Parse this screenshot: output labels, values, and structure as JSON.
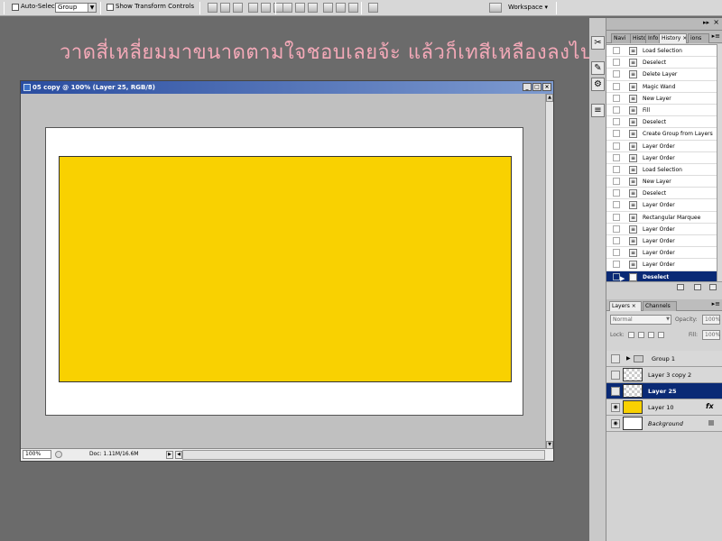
{
  "options_bar": {
    "auto_select_label": "Auto-Select:",
    "auto_select_value": "Group",
    "show_transform_label": "Show Transform Controls",
    "workspace_label": "Workspace"
  },
  "overlay_text": "วาดสี่เหลี่ยมมาขนาดตามใจชอบเลยจ้ะ แล้วก็เทสีเหลืองลงไป",
  "document": {
    "title": "05 copy @ 100% (Layer 25, RGB/8)",
    "zoom": "100%",
    "doc_info": "Doc: 1.11M/16.6M",
    "window_buttons": [
      "_",
      "□",
      "×"
    ],
    "rectangle_color": "#f9d101"
  },
  "history_panel": {
    "tabs": [
      "Navi",
      "Histo",
      "Info",
      "History",
      "ions"
    ],
    "items": [
      "Load Selection",
      "Deselect",
      "Delete Layer",
      "Magic Wand",
      "New Layer",
      "Fill",
      "Deselect",
      "Create Group from Layers",
      "Layer Order",
      "Layer Order",
      "Load Selection",
      "New Layer",
      "Deselect",
      "Layer Order",
      "Rectangular Marquee",
      "Layer Order",
      "Layer Order",
      "Layer Order",
      "Layer Order",
      "Deselect"
    ],
    "selected_item": "Deselect"
  },
  "layers_panel": {
    "tabs": [
      "Layers",
      "Channels"
    ],
    "blend_mode": "Normal",
    "opacity_label": "Opacity:",
    "opacity_value": "100%",
    "lock_label": "Lock:",
    "fill_label": "Fill:",
    "fill_value": "100%",
    "layers": [
      {
        "name": "Group 1",
        "kind": "group",
        "visible": false,
        "selected": false
      },
      {
        "name": "Layer 3 copy 2",
        "kind": "layer",
        "visible": false,
        "selected": false
      },
      {
        "name": "Layer 25",
        "kind": "layer",
        "visible": false,
        "selected": true
      },
      {
        "name": "Layer 10",
        "kind": "layer",
        "visible": true,
        "selected": false,
        "fx": "fx"
      },
      {
        "name": "Background",
        "kind": "background",
        "visible": true,
        "selected": false
      }
    ]
  },
  "colors": {
    "selection_blue": "#0a2a75",
    "overlay_pink": "#f4a9b8",
    "title_bar": "#2a4da0"
  }
}
